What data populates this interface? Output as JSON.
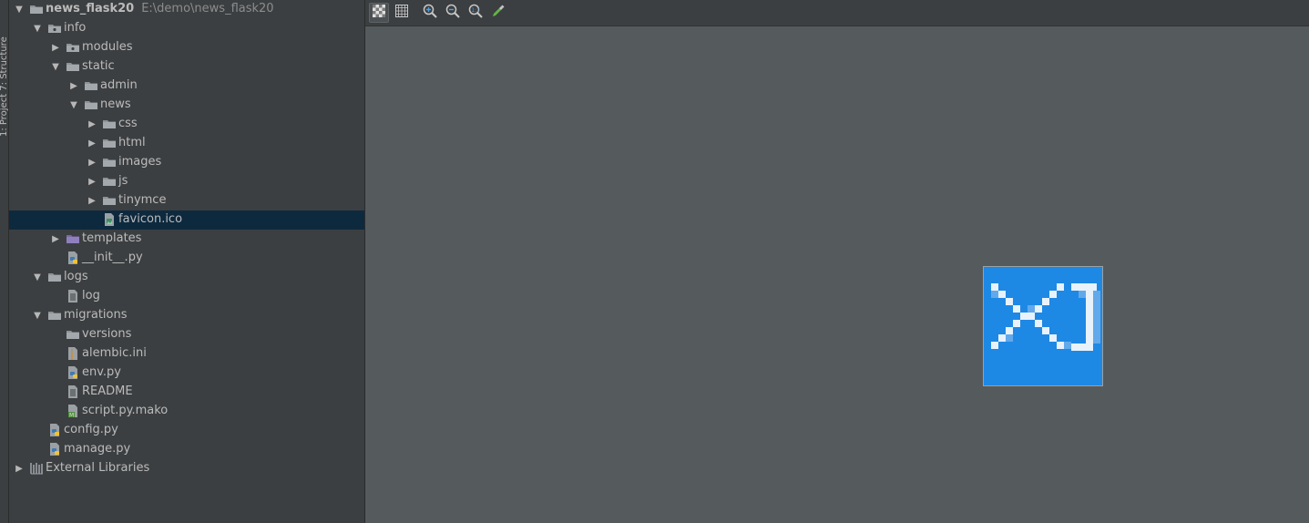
{
  "side_strip": {
    "label": "1: Project    7: Structure"
  },
  "tree": {
    "rows": [
      {
        "label": "news_flask20",
        "hint": "E:\\demo\\news_flask20",
        "icon": "folder-icon",
        "arrow": "down",
        "depth": 0
      },
      {
        "label": "info",
        "icon": "package-folder-icon",
        "arrow": "down",
        "depth": 1
      },
      {
        "label": "modules",
        "icon": "package-folder-icon",
        "arrow": "right",
        "depth": 2
      },
      {
        "label": "static",
        "icon": "folder-icon",
        "arrow": "down",
        "depth": 2
      },
      {
        "label": "admin",
        "icon": "folder-icon",
        "arrow": "right",
        "depth": 3
      },
      {
        "label": "news",
        "icon": "folder-icon",
        "arrow": "down",
        "depth": 3
      },
      {
        "label": "css",
        "icon": "folder-icon",
        "arrow": "right",
        "depth": 4
      },
      {
        "label": "html",
        "icon": "folder-icon",
        "arrow": "right",
        "depth": 4
      },
      {
        "label": "images",
        "icon": "folder-icon",
        "arrow": "right",
        "depth": 4
      },
      {
        "label": "js",
        "icon": "folder-icon",
        "arrow": "right",
        "depth": 4
      },
      {
        "label": "tinymce",
        "icon": "folder-icon",
        "arrow": "right",
        "depth": 4
      },
      {
        "label": "favicon.ico",
        "icon": "image-file-icon",
        "arrow": "none",
        "depth": 4,
        "selected": true
      },
      {
        "label": "templates",
        "icon": "templates-folder-icon",
        "arrow": "right",
        "depth": 2
      },
      {
        "label": "__init__.py",
        "icon": "python-file-icon",
        "arrow": "none",
        "depth": 2
      },
      {
        "label": "logs",
        "icon": "folder-icon",
        "arrow": "down",
        "depth": 1
      },
      {
        "label": "log",
        "icon": "text-file-icon",
        "arrow": "none",
        "depth": 2
      },
      {
        "label": "migrations",
        "icon": "folder-icon",
        "arrow": "down",
        "depth": 1
      },
      {
        "label": "versions",
        "icon": "folder-icon",
        "arrow": "none",
        "depth": 2
      },
      {
        "label": "alembic.ini",
        "icon": "ini-file-icon",
        "arrow": "none",
        "depth": 2
      },
      {
        "label": "env.py",
        "icon": "python-file-icon",
        "arrow": "none",
        "depth": 2
      },
      {
        "label": "README",
        "icon": "text-file-icon",
        "arrow": "none",
        "depth": 2
      },
      {
        "label": "script.py.mako",
        "icon": "mako-file-icon",
        "arrow": "none",
        "depth": 2
      },
      {
        "label": "config.py",
        "icon": "python-file-icon",
        "arrow": "none",
        "depth": 1
      },
      {
        "label": "manage.py",
        "icon": "python-file-icon",
        "arrow": "none",
        "depth": 1
      },
      {
        "label": "External Libraries",
        "icon": "libraries-icon",
        "arrow": "right",
        "depth": 0
      }
    ]
  },
  "toolbar": {
    "buttons": [
      {
        "name": "chessboard-background-button",
        "icon": "chessboard-icon",
        "active": true
      },
      {
        "name": "grid-toggle-button",
        "icon": "grid-icon",
        "active": false
      },
      {
        "name": "zoom-in-button",
        "icon": "zoom-in-icon",
        "active": false
      },
      {
        "name": "zoom-out-button",
        "icon": "zoom-out-icon",
        "active": false
      },
      {
        "name": "actual-size-button",
        "icon": "actual-size-icon",
        "active": false
      },
      {
        "name": "color-picker-button",
        "icon": "eyedropper-icon",
        "active": false
      }
    ]
  },
  "colors": {
    "panel_bg": "#3c3f41",
    "canvas_bg": "#555a5d",
    "selection_bg": "#0d293e",
    "favicon_blue": "#1e88e5"
  },
  "preview": {
    "alt": "favicon preview",
    "icon": "favicon-image"
  }
}
